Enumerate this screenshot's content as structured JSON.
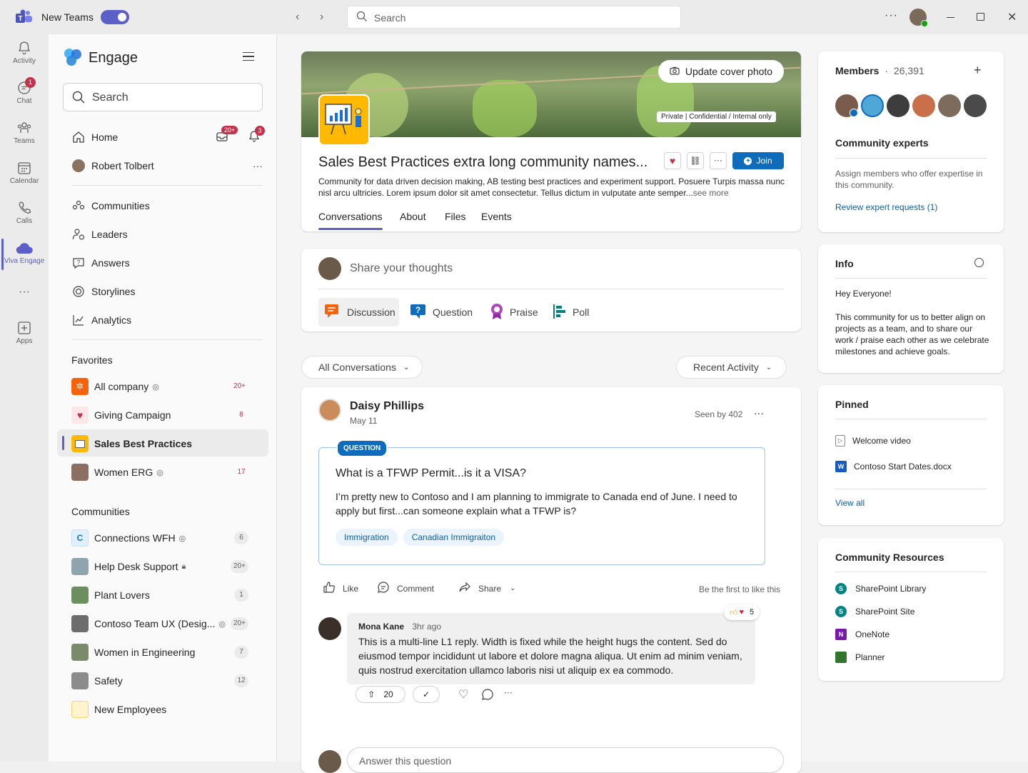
{
  "titlebar": {
    "app_name": "New Teams",
    "search_placeholder": "Search"
  },
  "rail": [
    {
      "label": "Activity",
      "icon": "bell-icon"
    },
    {
      "label": "Chat",
      "icon": "chat-icon",
      "badge": "1"
    },
    {
      "label": "Teams",
      "icon": "teams-icon"
    },
    {
      "label": "Calendar",
      "icon": "calendar-icon"
    },
    {
      "label": "Calls",
      "icon": "phone-icon"
    },
    {
      "label": "Viva Engage",
      "icon": "cloud-icon"
    },
    {
      "label": "Apps",
      "icon": "plus-square-icon"
    }
  ],
  "sidebar": {
    "app_title": "Engage",
    "search_placeholder": "Search",
    "home": "Home",
    "mail_badge": "20+",
    "bell_badge": "3",
    "user": "Robert Tolbert",
    "nav": [
      "Communities",
      "Leaders",
      "Answers",
      "Storylines",
      "Analytics"
    ],
    "favorites_heading": "Favorites",
    "favorites": [
      {
        "name": "All company",
        "count": "20+",
        "verified": true
      },
      {
        "name": "Giving Campaign",
        "count": "8"
      },
      {
        "name": "Sales Best Practices",
        "count": ""
      },
      {
        "name": "Women ERG",
        "count": "17",
        "verified": true
      }
    ],
    "communities_heading": "Communities",
    "communities": [
      {
        "name": "Connections WFH",
        "count": "6",
        "verified": true
      },
      {
        "name": "Help Desk Support",
        "count": "20+",
        "lock": true
      },
      {
        "name": "Plant Lovers",
        "count": "1"
      },
      {
        "name": "Contoso Team UX (Desig...",
        "count": "20+",
        "verified": true
      },
      {
        "name": "Women in Engineering",
        "count": "7"
      },
      {
        "name": "Safety",
        "count": "12"
      },
      {
        "name": "New Employees",
        "count": ""
      }
    ]
  },
  "header": {
    "cover_button": "Update cover photo",
    "classification": "Private | Confidential / Internal only",
    "title": "Sales Best Practices extra long community names...",
    "description": "Community for data driven decision making, AB testing best practices and experiment support. Posuere Turpis massa nunc nisl arcu ultricies. Lorem ipsum dolor sit amet consectetur. Tellus dictum in vulputate ante semper...",
    "see_more": "see more",
    "join": "Join",
    "tabs": [
      "Conversations",
      "About",
      "Files",
      "Events"
    ]
  },
  "composer": {
    "placeholder": "Share your thoughts",
    "types": [
      "Discussion",
      "Question",
      "Praise",
      "Poll"
    ]
  },
  "filters": {
    "left": "All Conversations",
    "right": "Recent Activity"
  },
  "post": {
    "author": "Daisy Phillips",
    "date": "May 11",
    "seen": "Seen by 402",
    "type_label": "QUESTION",
    "question_title": "What is a TFWP Permit...is it a VISA?",
    "question_body": "I’m pretty new to Contoso and I am planning to immigrate to Canada end of June. I need to apply but first...can someone explain what a TFWP is?",
    "tags": [
      "Immigration",
      "Canadian Immigraiton"
    ],
    "actions": [
      "Like",
      "Comment",
      "Share"
    ],
    "like_hint": "Be the first to like this",
    "reply": {
      "author": "Mona Kane",
      "time": "3hr ago",
      "text": "This is a multi-line L1 reply. Width is fixed while the height hugs the content. Sed do eiusmod tempor incididunt ut labore et dolore magna aliqua. Ut enim ad minim veniam, quis nostrud exercitation ullamco laboris nisi ut aliquip ex ea commodo.",
      "reaction_count": "5",
      "upvotes": "20"
    },
    "answer_placeholder": "Answer this question"
  },
  "right": {
    "members_label": "Members",
    "members_count": "26,391",
    "experts_title": "Community experts",
    "experts_text": "Assign members who offer expertise in this community.",
    "experts_link": "Review expert requests (1)",
    "info_title": "Info",
    "info_greeting": "Hey Everyone!",
    "info_text": "This community for us to better align on projects as a team, and to share our work / praise each other as we celebrate milestones and achieve goals.",
    "pinned_title": "Pinned",
    "pinned": [
      "Welcome video",
      "Contoso Start Dates.docx"
    ],
    "view_all": "View all",
    "resources_title": "Community Resources",
    "resources": [
      "SharePoint Library",
      "SharePoint Site",
      "OneNote",
      "Planner"
    ]
  }
}
